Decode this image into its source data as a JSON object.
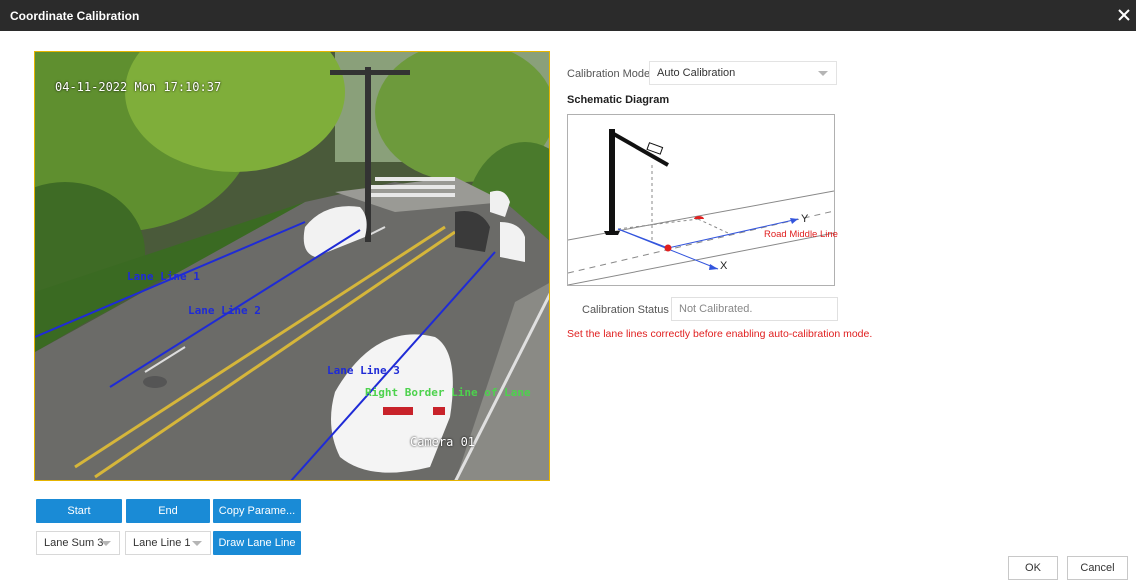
{
  "dialog": {
    "title": "Coordinate Calibration"
  },
  "video": {
    "timestamp": "04-11-2022 Mon 17:10:37",
    "camera_label": "Camera 01",
    "lane_labels": [
      "Lane Line 1",
      "Lane Line 2",
      "Lane Line 3"
    ],
    "boundary_label": "Right Border Line of Lane"
  },
  "controls": {
    "start_label": "Start",
    "end_label": "End",
    "copy_label": "Copy Parame...",
    "lane_sum_value": "Lane Sum 3",
    "lane_line_value": "Lane Line 1",
    "draw_label": "Draw Lane Line"
  },
  "calibration": {
    "mode_label": "Calibration Mode",
    "mode_value": "Auto Calibration",
    "schematic_heading": "Schematic Diagram",
    "diagram": {
      "axis_y": "Y",
      "axis_x": "X",
      "road_middle": "Road Middle Line"
    },
    "status_label": "Calibration Status",
    "status_value": "Not Calibrated.",
    "warning": "Set the lane lines correctly before enabling auto-calibration mode."
  },
  "footer": {
    "ok_label": "OK",
    "cancel_label": "Cancel"
  },
  "colors": {
    "titlebar": "#2b2b2b",
    "accent": "#1a8bd6",
    "lane_line": "#1f2bd6",
    "warning": "#e02020",
    "border_line_label": "#4dd24d"
  }
}
